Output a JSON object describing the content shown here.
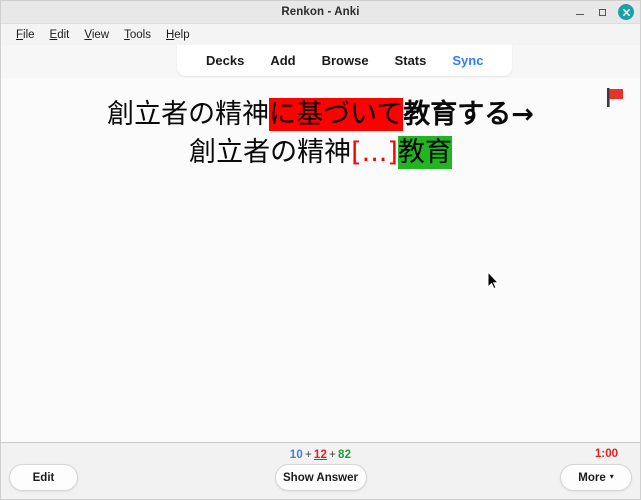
{
  "window": {
    "title": "Renkon - Anki",
    "controls": {
      "minimize": "–",
      "maximize": "□",
      "close": "✕"
    }
  },
  "menubar": {
    "items": [
      {
        "accel": "F",
        "rest": "ile"
      },
      {
        "accel": "E",
        "rest": "dit"
      },
      {
        "accel": "V",
        "rest": "iew"
      },
      {
        "accel": "T",
        "rest": "ools"
      },
      {
        "accel": "H",
        "rest": "elp"
      }
    ]
  },
  "nav": {
    "items": [
      {
        "label": "Decks",
        "accent": false
      },
      {
        "label": "Add",
        "accent": false
      },
      {
        "label": "Browse",
        "accent": false
      },
      {
        "label": "Stats",
        "accent": false
      },
      {
        "label": "Sync",
        "accent": true
      }
    ],
    "sync_color": "#2d7ff9"
  },
  "card": {
    "flag": "red-flag",
    "flag_color": "#e8332a",
    "line1": {
      "plain_prefix": "創立者の精神",
      "highlight_red": "に基づいて",
      "bold_suffix": "教育する→"
    },
    "line2": {
      "plain_prefix": "創立者の精神",
      "cloze": "[...]",
      "highlight_green": "教育"
    },
    "colors": {
      "red_highlight": "#ff0000",
      "green_highlight": "#22b422",
      "cloze_red": "#ff0000"
    }
  },
  "bottom": {
    "counts": {
      "new": "10",
      "sep1": "+",
      "learning": "12",
      "sep2": "+",
      "due": "82",
      "new_color": "#4a7ddb",
      "learning_color": "#e02020",
      "due_color": "#1f9c3a"
    },
    "timer": "1:00",
    "timer_color": "#e02020",
    "edit_label": "Edit",
    "show_answer_label": "Show Answer",
    "more_label": "More",
    "more_caret": "▾"
  }
}
